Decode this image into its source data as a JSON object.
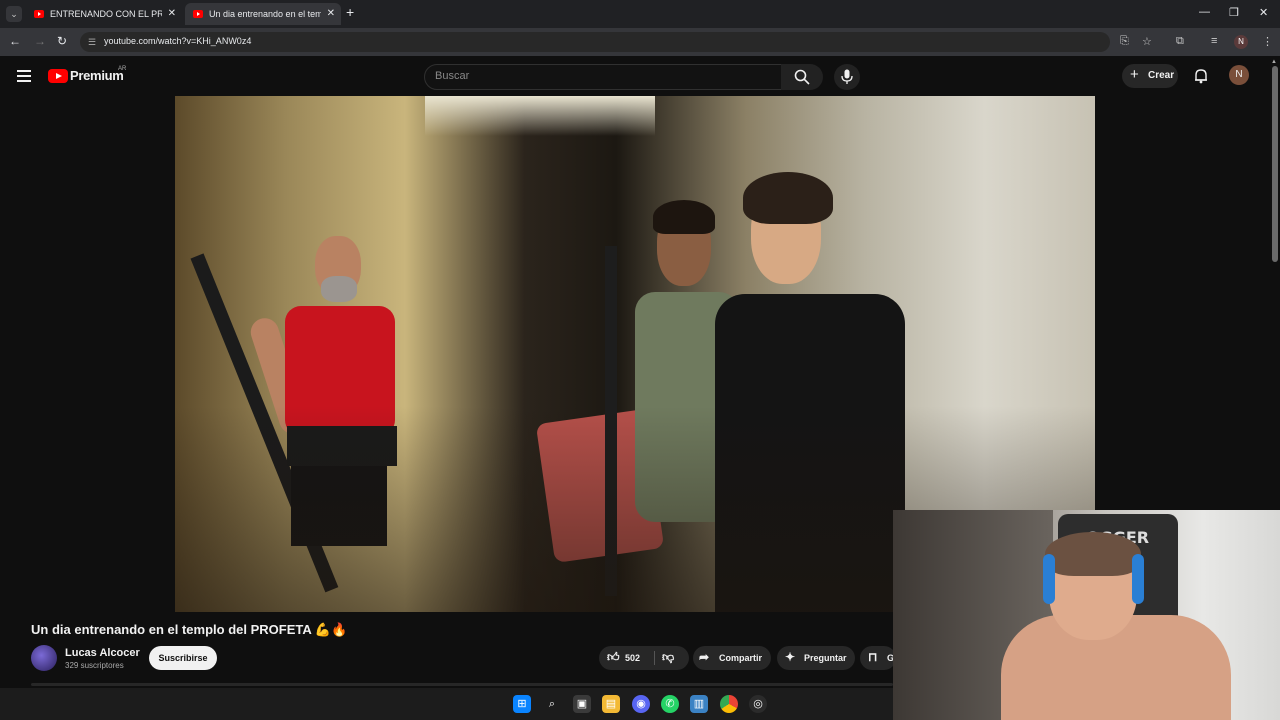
{
  "browser": {
    "tabs": [
      {
        "title": "ENTRENANDO CON EL PROFETA",
        "close": "✕"
      },
      {
        "title": "Un dia entrenando en el templo",
        "close": "✕"
      }
    ],
    "new_tab": "+",
    "url": "youtube.com/watch?v=KHi_ANW0z4",
    "profile_initial": "N",
    "window_controls": {
      "minimize": "—",
      "restore": "❐",
      "close": "✕"
    }
  },
  "youtube": {
    "logo_text": "Premium",
    "region": "AR",
    "search_placeholder": "Buscar",
    "create_label": "Crear",
    "avatar_initial": "N"
  },
  "video": {
    "title": "Un dia entrenando en el templo del PROFETA 💪🔥",
    "channel": "Lucas Alcocer",
    "subscribers": "329 suscriptores",
    "subscribe_label": "Suscribirse",
    "likes": "502",
    "share_label": "Compartir",
    "ask_label": "Preguntar",
    "save_label_partial": "G"
  },
  "webcam": {
    "chair_text": "OGGER"
  },
  "taskbar": {
    "icons": [
      "windows-start-icon",
      "search-icon",
      "task-view-icon",
      "file-explorer-icon",
      "discord-icon",
      "whatsapp-icon",
      "notepad-icon",
      "chrome-icon",
      "obs-icon"
    ]
  },
  "colors": {
    "yt_red": "#ff0000",
    "bg": "#0f0f0f",
    "pill": "#272727"
  }
}
